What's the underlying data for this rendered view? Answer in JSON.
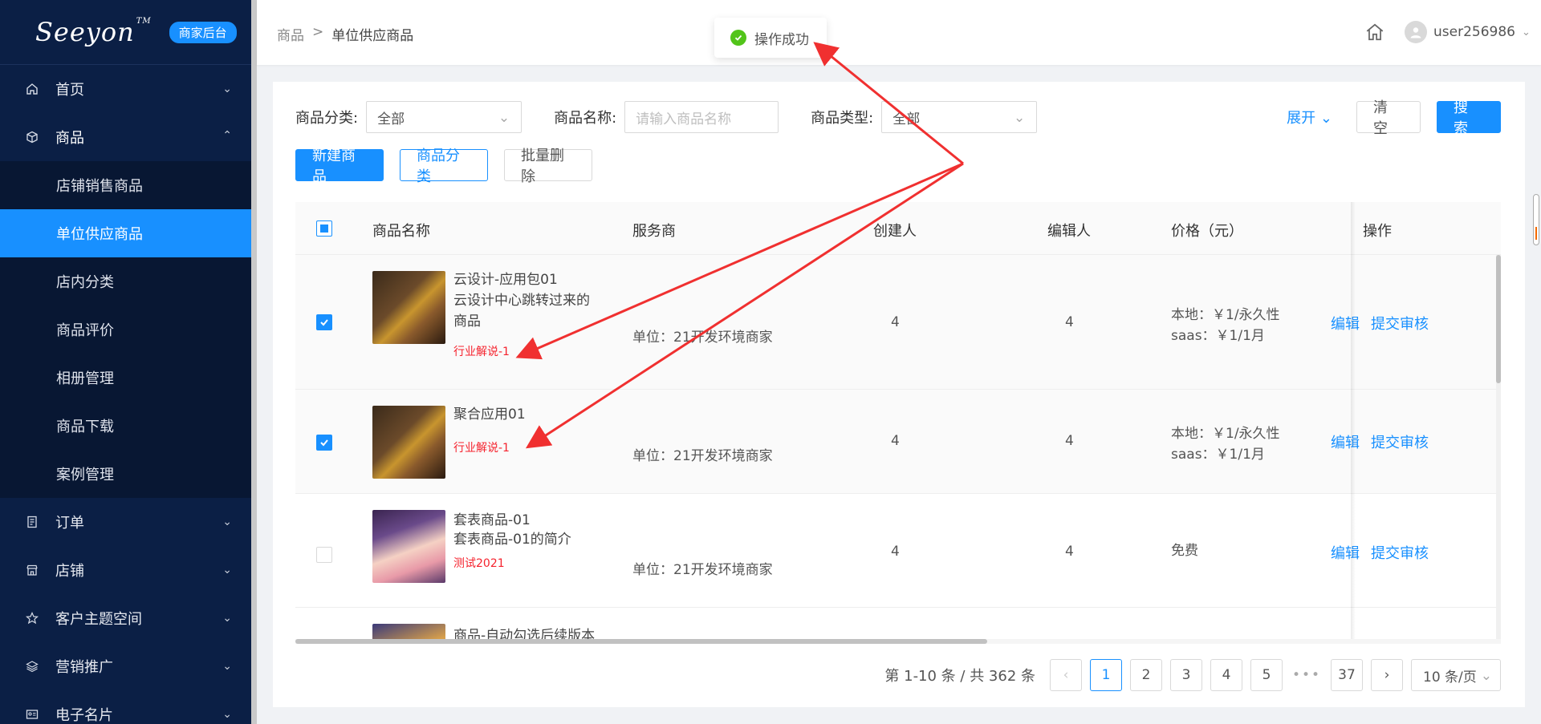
{
  "sidebar": {
    "logo": "Seeyon",
    "logo_tm": "TM",
    "badge": "商家后台",
    "menu": [
      {
        "label": "首页",
        "icon": "home-icon"
      },
      {
        "label": "商品",
        "icon": "cube-icon"
      },
      {
        "label": "订单",
        "icon": "order-icon"
      },
      {
        "label": "店铺",
        "icon": "store-icon"
      },
      {
        "label": "客户主题空间",
        "icon": "star-icon"
      },
      {
        "label": "营销推广",
        "icon": "layers-icon"
      },
      {
        "label": "电子名片",
        "icon": "card-icon"
      }
    ],
    "submenu": [
      "店铺销售商品",
      "单位供应商品",
      "店内分类",
      "商品评价",
      "相册管理",
      "商品下载",
      "案例管理"
    ]
  },
  "header": {
    "breadcrumb_root": "商品",
    "breadcrumb_sep": ">",
    "breadcrumb_current": "单位供应商品",
    "username": "user256986"
  },
  "toast": {
    "text": "操作成功"
  },
  "filters": {
    "category_label": "商品分类:",
    "category_value": "全部",
    "name_label": "商品名称:",
    "name_placeholder": "请输入商品名称",
    "type_label": "商品类型:",
    "type_value": "全部",
    "expand_label": "展开",
    "clear_label": "清 空",
    "search_label": "搜 索"
  },
  "toolbar": {
    "new_label": "新建商品",
    "category_label": "商品分类",
    "batch_delete_label": "批量删除"
  },
  "table": {
    "columns": [
      "商品名称",
      "服务商",
      "创建人",
      "编辑人",
      "价格（元）",
      "操作"
    ],
    "rows": [
      {
        "name": "云设计-应用包01",
        "desc": "云设计中心跳转过来的商品",
        "tag": "行业解说-1",
        "provider": "单位：21开发环境商家",
        "creator": "4",
        "editor": "4",
        "price1": "本地：￥1/永久性",
        "price2": "saas：￥1/1月",
        "checked": true
      },
      {
        "name": "聚合应用01",
        "desc": "",
        "tag": "行业解说-1",
        "provider": "单位：21开发环境商家",
        "creator": "4",
        "editor": "4",
        "price1": "本地：￥1/永久性",
        "price2": "saas：￥1/1月",
        "checked": true
      },
      {
        "name": "套表商品-01",
        "desc": "套表商品-01的简介",
        "tag": "测试2021",
        "provider": "单位：21开发环境商家",
        "creator": "4",
        "editor": "4",
        "price1": "免费",
        "price2": "",
        "checked": false
      },
      {
        "name": "商品-自动勾选后续版本",
        "desc": "",
        "tag": "",
        "provider": "",
        "creator": "",
        "editor": "",
        "price1": "",
        "price2": "",
        "checked": false
      }
    ],
    "edit_label": "编辑",
    "submit_label": "提交审核"
  },
  "pagination": {
    "total_text": "第 1-10 条 / 共 362 条",
    "pages": [
      "1",
      "2",
      "3",
      "4",
      "5"
    ],
    "last_page": "37",
    "current": "1",
    "page_size": "10 条/页"
  },
  "colors": {
    "primary": "#1890ff",
    "sidebar_bg": "#0b1f45",
    "tag_red": "#f5222d",
    "success": "#52c41a",
    "annotation": "#f03030"
  }
}
